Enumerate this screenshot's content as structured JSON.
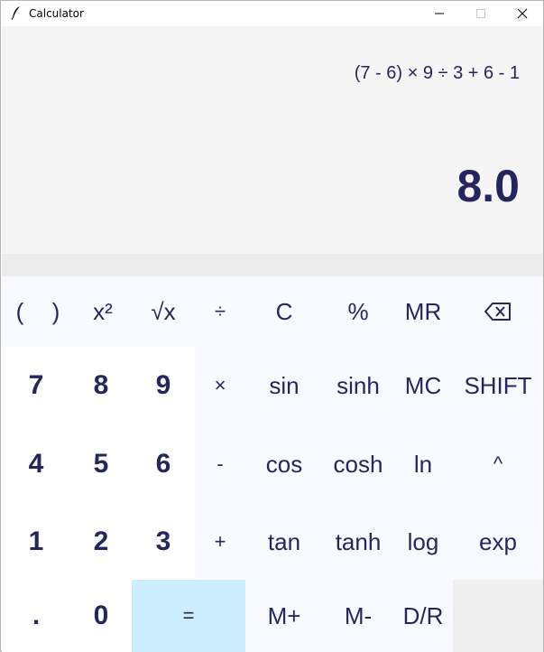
{
  "window": {
    "title": "Calculator",
    "controls": {
      "minimize": "minimize-icon",
      "maximize": "maximize-icon",
      "close": "close-icon"
    }
  },
  "display": {
    "expression": "(7 - 6) × 9 ÷ 3 + 6 - 1",
    "result": "8.0"
  },
  "keys": {
    "lparen": "(",
    "rparen": ")",
    "square": "x²",
    "sqrt": "√x",
    "divide": "÷",
    "clear": "C",
    "percent": "%",
    "mr": "MR",
    "backspace": "⌫",
    "seven": "7",
    "eight": "8",
    "nine": "9",
    "multiply": "×",
    "sin": "sin",
    "sinh": "sinh",
    "mc": "MC",
    "shift": "SHIFT",
    "four": "4",
    "five": "5",
    "six": "6",
    "minus": "-",
    "cos": "cos",
    "cosh": "cosh",
    "ln": "ln",
    "power": "^",
    "one": "1",
    "two": "2",
    "three": "3",
    "plus": "+",
    "tan": "tan",
    "tanh": "tanh",
    "log": "log",
    "exp": "exp",
    "dot": ".",
    "zero": "0",
    "equals": "=",
    "mplus": "M+",
    "mminus": "M-",
    "dr": "D/R"
  },
  "colors": {
    "text": "#25265e",
    "display_bg": "#f5f5f5",
    "keypad_bg": "#f8faff",
    "digit_bg": "#ffffff",
    "equals_bg": "#cceeff"
  }
}
